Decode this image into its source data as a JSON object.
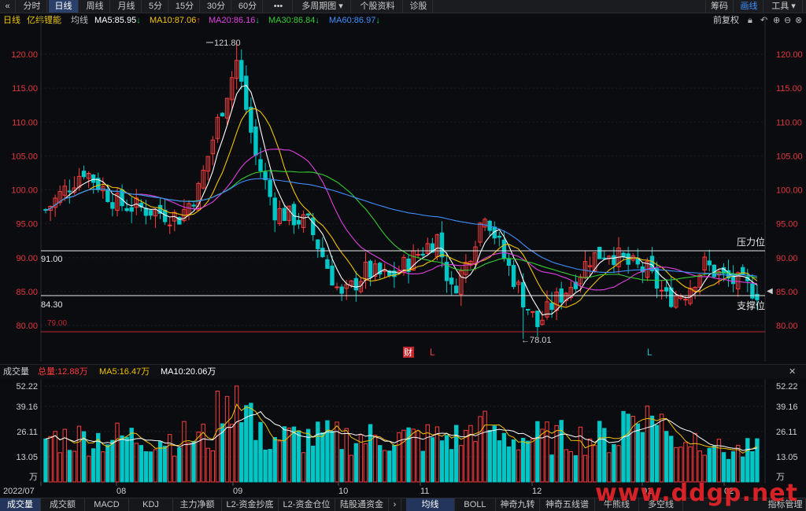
{
  "topbar": {
    "back_glyph": "«",
    "tabs": [
      "分时",
      "日线",
      "周线",
      "月线",
      "5分",
      "15分",
      "30分",
      "60分",
      "•••",
      "多周期图",
      "个股资料",
      "诊股"
    ],
    "active_tab": "日线",
    "right": [
      "筹码",
      "画线",
      "工具"
    ]
  },
  "ma_line": {
    "period": "日线",
    "stock_name": "亿纬锂能",
    "label_avg": "均线",
    "ma5": "MA5:85.95",
    "ma10": "MA10:87.06",
    "ma20": "MA20:86.16",
    "ma30": "MA30:86.84",
    "ma60": "MA60:86.97",
    "right_label": "前复权"
  },
  "price_axis_labels": [
    "120.00",
    "115.00",
    "110.00",
    "105.00",
    "100.00",
    "95.00",
    "90.00",
    "85.00",
    "80.00"
  ],
  "annotations": {
    "high": "121.80",
    "low": "←78.01",
    "line_91": "91.00",
    "line_84": "84.30",
    "line_79": "79.00",
    "resistance": "压力位",
    "support": "支撑位",
    "cai": "财",
    "l1": "L",
    "l2": "L"
  },
  "volume_row": {
    "title": "成交量",
    "total": "总量:12.88万",
    "ma5": "MA5:16.47万",
    "ma10": "MA10:20.06万"
  },
  "volume_axis_labels": [
    "52.22",
    "39.16",
    "26.11",
    "13.05",
    "万"
  ],
  "date_labels": [
    "2022/07",
    "08",
    "09",
    "10",
    "11",
    "12",
    "01",
    "02"
  ],
  "bottombar": {
    "tabs": [
      "成交量",
      "成交额",
      "MACD",
      "KDJ",
      "主力净额",
      "L2-资金抄底",
      "L2-资金仓位",
      "陆股通资金"
    ],
    "right_tabs": [
      "均线",
      "BOLL",
      "神奇九转",
      "神奇五线谱",
      "牛熊线",
      "多空线"
    ],
    "last": "指标管理"
  },
  "watermark": "www.ddgp.net",
  "colors": {
    "up": "#ff3b3b",
    "down": "#00c6c6",
    "ma5": "#ffffff",
    "ma10": "#f2c200",
    "ma20": "#e040e0",
    "ma30": "#33cc33",
    "ma60": "#3f8fff"
  }
}
